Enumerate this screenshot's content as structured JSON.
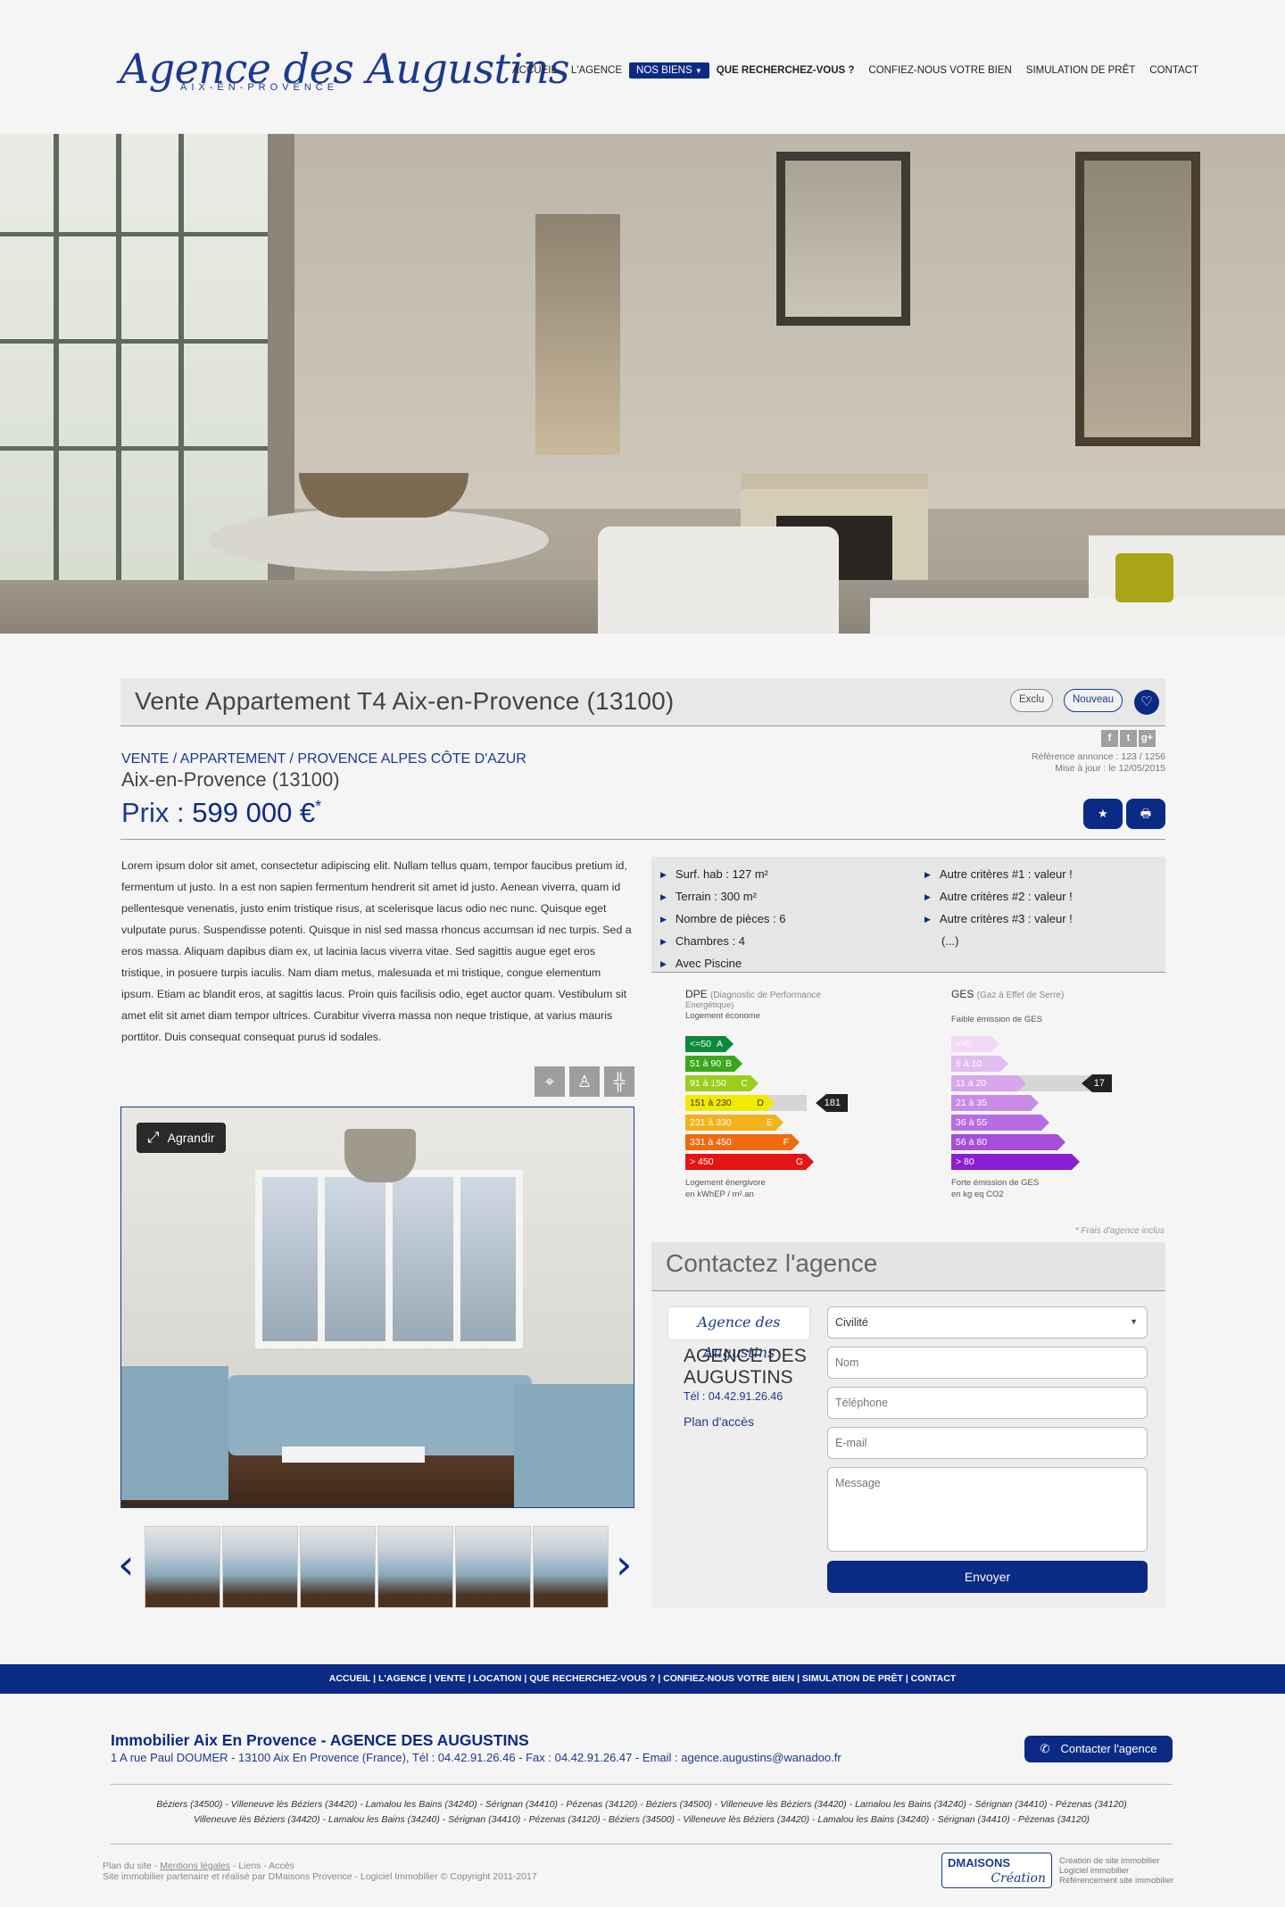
{
  "header": {
    "logo_main": "Agence des Augustins",
    "logo_sub": "AIX-EN-PROVENCE",
    "nav": [
      "ACCUEIL",
      "L'AGENCE",
      "NOS BIENS",
      "QUE RECHERCHEZ-VOUS ?",
      "CONFIEZ-NOUS VOTRE BIEN",
      "SIMULATION DE PRÊT",
      "CONTACT"
    ]
  },
  "listing": {
    "title": "Vente Appartement T4 Aix-en-Provence (13100)",
    "badges": [
      "Exclu",
      "Nouveau"
    ],
    "social": [
      "f",
      "t",
      "g+"
    ],
    "reference": "Référence annonce : 123 / 1256",
    "updated": "Mise à jour : le 12/05/2015",
    "breadcrumb": "VENTE / APPARTEMENT / PROVENCE ALPES CÔTE D'AZUR",
    "city": "Aix-en-Provence (13100)",
    "price_label": "Prix :",
    "price_value": "599 000 €",
    "price_star": "*",
    "description": "Lorem ipsum dolor sit amet, consectetur adipiscing elit. Nullam tellus quam, tempor faucibus pretium id, fermentum ut justo. In a est non sapien fermentum hendrerit sit amet id justo. Aenean viverra, quam id pellentesque venenatis, justo enim tristique risus, at scelerisque lacus odio nec nunc. Quisque eget vulputate purus. Suspendisse potenti. Quisque in nisl sed massa rhoncus accumsan id nec turpis. Sed a eros massa. Aliquam dapibus diam ex, ut lacinia lacus viverra vitae. Sed sagittis augue eget eros tristique, in posuere turpis iaculis. Nam diam metus, malesuada et mi tristique, congue elementum ipsum. Etiam ac blandit eros, at sagittis lacus. Proin quis facilisis odio, eget auctor quam. Vestibulum sit amet elit sit amet diam tempor ultrices. Curabitur viverra massa non neque tristique, at varius mauris porttitor. Duis consequat consequat purus id sodales.",
    "features_left": [
      "Surf. hab : 127 m²",
      "Terrain : 300 m²",
      "Nombre de pièces : 6",
      "Chambres : 4",
      "Avec Piscine"
    ],
    "features_right": [
      "Autre critères #1 : valeur !",
      "Autre critères #2 : valeur !",
      "Autre critères #3 : valeur !",
      "(...)"
    ],
    "enlarge_label": "Agrandir",
    "frais": "* Frais d'agence inclus"
  },
  "dpe": {
    "title": "DPE",
    "subtitle_a": "(Diagnostic de Performance",
    "subtitle_b": "Energétique)",
    "top": "Logement économe",
    "bottom_a": "Logement énergivore",
    "bottom_b": "en kWhEP / m².an",
    "value": "181",
    "classes": [
      {
        "label": "<=50",
        "letter": "A",
        "color": "#0a8a3a"
      },
      {
        "label": "51 à 90",
        "letter": "B",
        "color": "#3aa81c"
      },
      {
        "label": "91 à 150",
        "letter": "C",
        "color": "#9ccd1c"
      },
      {
        "label": "151 à 230",
        "letter": "D",
        "color": "#f2eb00"
      },
      {
        "label": "231 à 330",
        "letter": "E",
        "color": "#f4b21a"
      },
      {
        "label": "331 à 450",
        "letter": "F",
        "color": "#ee6b12"
      },
      {
        "label": "> 450",
        "letter": "G",
        "color": "#e41414"
      }
    ]
  },
  "ges": {
    "title": "GES",
    "subtitle": "(Gaz à Effet de Serre)",
    "top": "Faible émission de GES",
    "bottom_a": "Forte émission de GES",
    "bottom_b": "en kg eq CO2",
    "value": "17",
    "classes": [
      {
        "label": "<=5",
        "color": "#f1d9f6"
      },
      {
        "label": "6 à 10",
        "color": "#e3bdf0"
      },
      {
        "label": "11 à 20",
        "color": "#d7a6ec"
      },
      {
        "label": "21 à 35",
        "color": "#c98be8"
      },
      {
        "label": "36 à 55",
        "color": "#b96ce2"
      },
      {
        "label": "56 à 80",
        "color": "#a54ed9"
      },
      {
        "label": "> 80",
        "color": "#8a1fd0"
      }
    ]
  },
  "contact": {
    "title": "Contactez l'agence",
    "logo": "Agence des Augustins",
    "agency_name": "AGENCE DES AUGUSTINS",
    "tel": "Tél : 04.42.91.26.46",
    "plan": "Plan d'accès",
    "civility": "Civilité",
    "name_ph": "Nom",
    "phone_ph": "Téléphone",
    "email_ph": "E-mail",
    "message_ph": "Message",
    "submit": "Envoyer"
  },
  "footer": {
    "nav": "ACCUEIL | L'AGENCE | VENTE | LOCATION | QUE RECHERCHEZ-VOUS ? | CONFIEZ-NOUS VOTRE BIEN | SIMULATION DE PRÊT | CONTACT",
    "title": "Immobilier Aix En Provence - AGENCE DES AUGUSTINS",
    "address": "1 A rue Paul DOUMER - 13100 Aix En Provence (France), Tél : 04.42.91.26.46 - Fax : 04.42.91.26.47 - Email : agence.augustins@wanadoo.fr",
    "contact_button": "Contacter l'agence",
    "towns_1": "Béziers (34500) - Villeneuve lès Béziers (34420) - Lamalou les Bains (34240) - Sérignan (34410) - Pézenas (34120) - Béziers (34500) - Villeneuve lès Béziers (34420) - Lamalou les Bains (34240) - Sérignan (34410) - Pézenas (34120)",
    "towns_2": "Villeneuve lès Béziers (34420) - Lamalou les Bains (34240) - Sérignan (34410) - Pézenas (34120) - Béziers (34500) - Villeneuve lès Béziers (34420) - Lamalou les Bains (34240) - Sérignan (34410) - Pézenas (34120)",
    "links_a": "Plan du site - ",
    "links_b": "Mentions légales",
    "links_c": " - Liens - Accès",
    "credit": "Site immobilier partenaire et réalisé par DMaisons Provence - Logiciel Immobilier © Copyright 2011-2017",
    "dm_logo_1": "DMAISONS",
    "dm_logo_2": "Création",
    "dm_text": [
      "Création de site immobilier",
      "Logiciel immobilier",
      "Référencement site immobilier"
    ]
  }
}
